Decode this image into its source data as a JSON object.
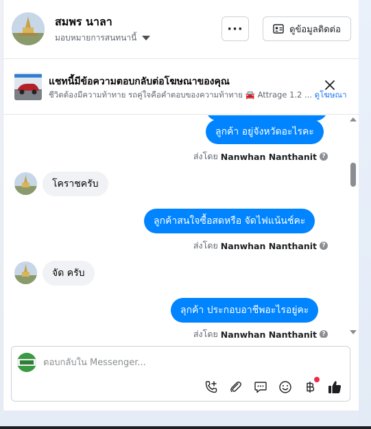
{
  "header": {
    "name": "สมพร นาลา",
    "assign_label": "มอบหมายการสนทนานี้",
    "more_label": "···",
    "contact_label": "ดูข้อมูลติดต่อ"
  },
  "ad": {
    "title": "แชทนี้มีข้อความตอบกลับต่อโฆษณาของคุณ",
    "subtitle": "ชีวิตต้องมีความท้าทาย รถคู่ใจคือคำตอบของความท้าทาย 🚘 Attrage 1.2 ...",
    "link": "ดูโฆษณา"
  },
  "messages": [
    {
      "type": "out",
      "text": "ลูกค้า อยู่จังหวัดอะไรคะ"
    },
    {
      "type": "sent_by",
      "prefix": "ส่งโดย",
      "author": "Nanwhan Nanthanit"
    },
    {
      "type": "in",
      "text": "โคราชครับ"
    },
    {
      "type": "out",
      "text": "ลูกค้าสนใจซื้อสดหรือ  จัดไฟแน้นช์คะ"
    },
    {
      "type": "sent_by",
      "prefix": "ส่งโดย",
      "author": "Nanwhan Nanthanit"
    },
    {
      "type": "in",
      "text": "จัด ครับ"
    },
    {
      "type": "out",
      "text": "ลุกค้า  ประกอบอาชีพอะไรอยู่คะ"
    },
    {
      "type": "sent_by",
      "prefix": "ส่งโดย",
      "author": "Nanwhan Nanthanit"
    }
  ],
  "composer": {
    "placeholder": "ตอบกลับใน Messenger...",
    "tools": [
      "phone-add-icon",
      "paperclip-icon",
      "saved-reply-icon",
      "emoji-icon",
      "baht-payment-icon",
      "thumbs-up-icon"
    ]
  },
  "colors": {
    "accent": "#0084ff",
    "link": "#1877f2",
    "incoming_bubble": "#f0f2f5",
    "notification_dot": "#f02849"
  }
}
